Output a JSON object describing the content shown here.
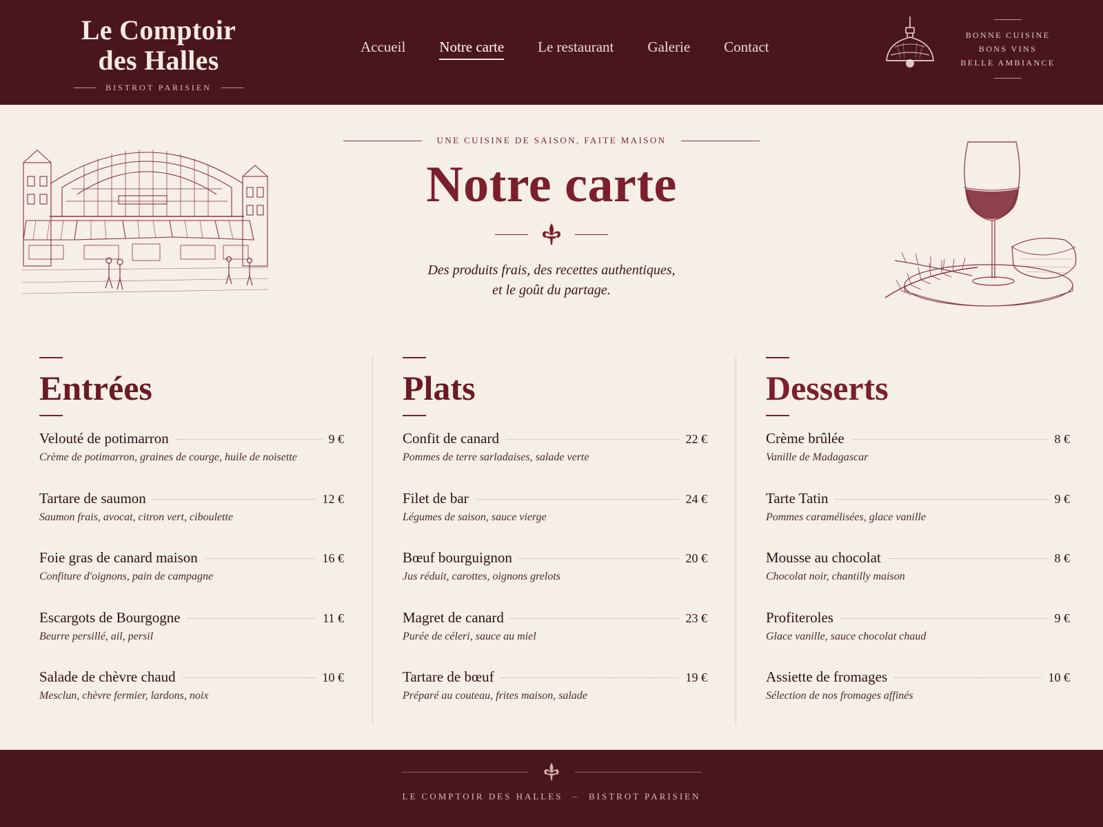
{
  "brand": {
    "name_line1": "Le Comptoir",
    "name_line2": "des Halles",
    "subtitle": "BISTROT PARISIEN"
  },
  "nav": {
    "items": [
      {
        "label": "Accueil",
        "active": false
      },
      {
        "label": "Notre carte",
        "active": true
      },
      {
        "label": "Le restaurant",
        "active": false
      },
      {
        "label": "Galerie",
        "active": false
      },
      {
        "label": "Contact",
        "active": false
      }
    ]
  },
  "header_tagline": {
    "line1": "BONNE CUISINE",
    "line2": "BONS VINS",
    "line3": "BELLE AMBIANCE"
  },
  "hero": {
    "kicker": "UNE CUISINE DE SAISON, FAITE MAISON",
    "title": "Notre carte",
    "subtitle_line1": "Des produits frais, des recettes authentiques,",
    "subtitle_line2": "et le goût du partage."
  },
  "menu": {
    "sections": [
      {
        "title": "Entrées",
        "items": [
          {
            "name": "Velouté de potimarron",
            "price": "9 €",
            "desc": "Crème de potimarron, graines de courge, huile de noisette"
          },
          {
            "name": "Tartare de saumon",
            "price": "12 €",
            "desc": "Saumon frais, avocat, citron vert, ciboulette"
          },
          {
            "name": "Foie gras de canard maison",
            "price": "16 €",
            "desc": "Confiture d'oignons, pain de campagne"
          },
          {
            "name": "Escargots de Bourgogne",
            "price": "11 €",
            "desc": "Beurre persillé, ail, persil"
          },
          {
            "name": "Salade de chèvre chaud",
            "price": "10 €",
            "desc": "Mesclun, chèvre fermier, lardons, noix"
          }
        ]
      },
      {
        "title": "Plats",
        "items": [
          {
            "name": "Confit de canard",
            "price": "22 €",
            "desc": "Pommes de terre sarladaises, salade verte"
          },
          {
            "name": "Filet de bar",
            "price": "24 €",
            "desc": "Légumes de saison, sauce vierge"
          },
          {
            "name": "Bœuf bourguignon",
            "price": "20 €",
            "desc": "Jus réduit, carottes, oignons grelots"
          },
          {
            "name": "Magret de canard",
            "price": "23 €",
            "desc": "Purée de céleri, sauce au miel"
          },
          {
            "name": "Tartare de bœuf",
            "price": "19 €",
            "desc": "Préparé au couteau, frites maison, salade"
          }
        ]
      },
      {
        "title": "Desserts",
        "items": [
          {
            "name": "Crème brûlée",
            "price": "8 €",
            "desc": "Vanille de Madagascar"
          },
          {
            "name": "Tarte Tatin",
            "price": "9 €",
            "desc": "Pommes caramélisées, glace vanille"
          },
          {
            "name": "Mousse au chocolat",
            "price": "8 €",
            "desc": "Chocolat noir, chantilly maison"
          },
          {
            "name": "Profiteroles",
            "price": "9 €",
            "desc": "Glace vanille, sauce chocolat chaud"
          },
          {
            "name": "Assiette de fromages",
            "price": "10 €",
            "desc": "Sélection de nos fromages affinés"
          }
        ]
      }
    ]
  },
  "footer": {
    "left": "LE COMPTOIR DES HALLES",
    "separator": "–",
    "right": "BISTROT PARISIEN"
  },
  "icons": {
    "lamp": "pendant-lamp-icon",
    "fleur": "fleur-de-lis-icon"
  },
  "colors": {
    "header_bg": "#4a161d",
    "page_bg": "#f5efe6",
    "accent": "#7b1f2c"
  }
}
